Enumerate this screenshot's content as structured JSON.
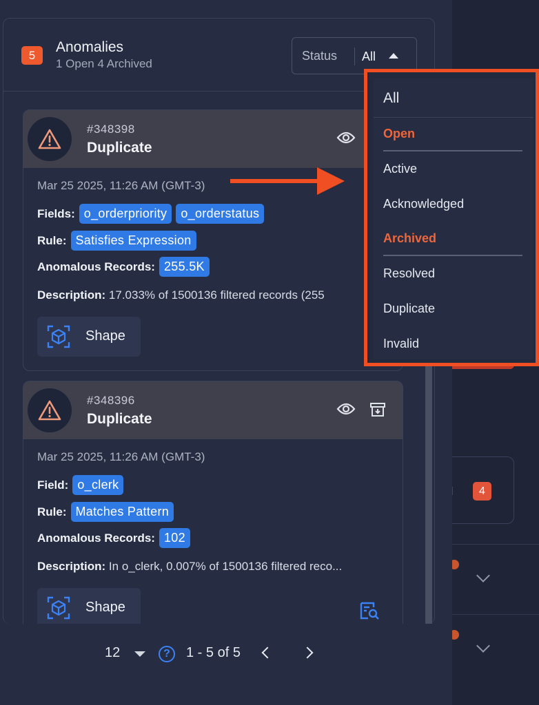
{
  "header": {
    "count": "5",
    "title": "Anomalies",
    "subtitle": "1 Open 4 Archived",
    "status_label": "Status",
    "status_value": "All"
  },
  "anomalies": [
    {
      "id": "#348398",
      "type": "Duplicate",
      "date": "Mar 25 2025, 11:26 AM (GMT-3)",
      "fields_label": "Fields:",
      "fields": [
        "o_orderpriority",
        "o_orderstatus"
      ],
      "rule_label": "Rule:",
      "rule": "Satisfies Expression",
      "records_label": "Anomalous Records:",
      "records": "255.5K",
      "description_label": "Description:",
      "description": "17.033% of 1500136 filtered records (255",
      "shape_label": "Shape"
    },
    {
      "id": "#348396",
      "type": "Duplicate",
      "date": "Mar 25 2025, 11:26 AM (GMT-3)",
      "fields_label": "Field:",
      "fields": [
        "o_clerk"
      ],
      "rule_label": "Rule:",
      "rule": "Matches Pattern",
      "records_label": "Anomalous Records:",
      "records": "102",
      "description_label": "Description:",
      "description": "In o_clerk, 0.007% of 1500136 filtered reco...",
      "shape_label": "Shape"
    }
  ],
  "dropdown": {
    "all": "All",
    "open_heading": "Open",
    "active": "Active",
    "acknowledged": "Acknowledged",
    "archived_heading": "Archived",
    "resolved": "Resolved",
    "duplicate": "Duplicate",
    "invalid": "Invalid"
  },
  "pagination": {
    "per_page": "12",
    "help": "?",
    "range": "1 - 5 of 5"
  },
  "background": {
    "ghost_text": "d",
    "badge": "4"
  },
  "colors": {
    "accent_orange": "#f04e23",
    "chip_blue": "#2f7ae5",
    "panel": "#262d42"
  }
}
